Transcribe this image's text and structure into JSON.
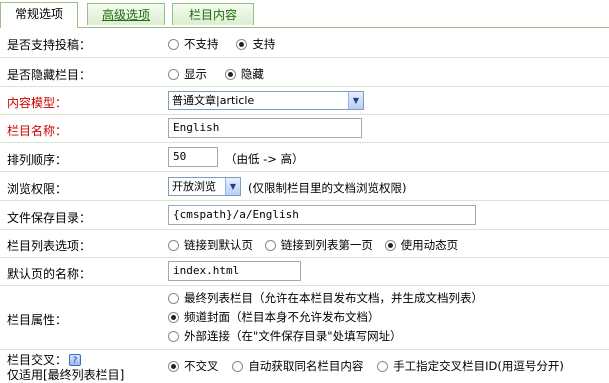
{
  "tabs": [
    {
      "label": "常规选项"
    },
    {
      "label": "高级选项"
    },
    {
      "label": "栏目内容"
    }
  ],
  "rows": {
    "submit": {
      "label": "是否支持投稿：",
      "options": [
        "不支持",
        "支持"
      ],
      "selected": 1
    },
    "hidden": {
      "label": "是否隐藏栏目：",
      "options": [
        "显示",
        "隐藏"
      ],
      "selected": 1
    },
    "model": {
      "label": "内容模型：",
      "value": "普通文章|article"
    },
    "name": {
      "label": "栏目名称：",
      "value": "English"
    },
    "order": {
      "label": "排列顺序：",
      "value": "50",
      "hint": "（由低 -> 高）"
    },
    "access": {
      "label": "浏览权限：",
      "value": "开放浏览",
      "hint": "(仅限制栏目里的文档浏览权限)"
    },
    "path": {
      "label": "文件保存目录：",
      "value": "{cmspath}/a/English"
    },
    "list_option": {
      "label": "栏目列表选项：",
      "options": [
        "链接到默认页",
        "链接到列表第一页",
        "使用动态页"
      ],
      "selected": 2
    },
    "default_page": {
      "label": "默认页的名称：",
      "value": "index.html"
    },
    "attr": {
      "label": "栏目属性：",
      "options": [
        "最终列表栏目（允许在本栏目发布文档，并生成文档列表）",
        "频道封面（栏目本身不允许发布文档）",
        "外部连接（在\"文件保存目录\"处填写网址）"
      ],
      "selected": 1
    },
    "cross": {
      "label": "栏目交叉：",
      "label2": "仅适用[最终列表栏目]",
      "options": [
        "不交叉",
        "自动获取同名栏目内容",
        "手工指定交叉栏目ID(用逗号分开)"
      ],
      "selected": 0
    }
  }
}
